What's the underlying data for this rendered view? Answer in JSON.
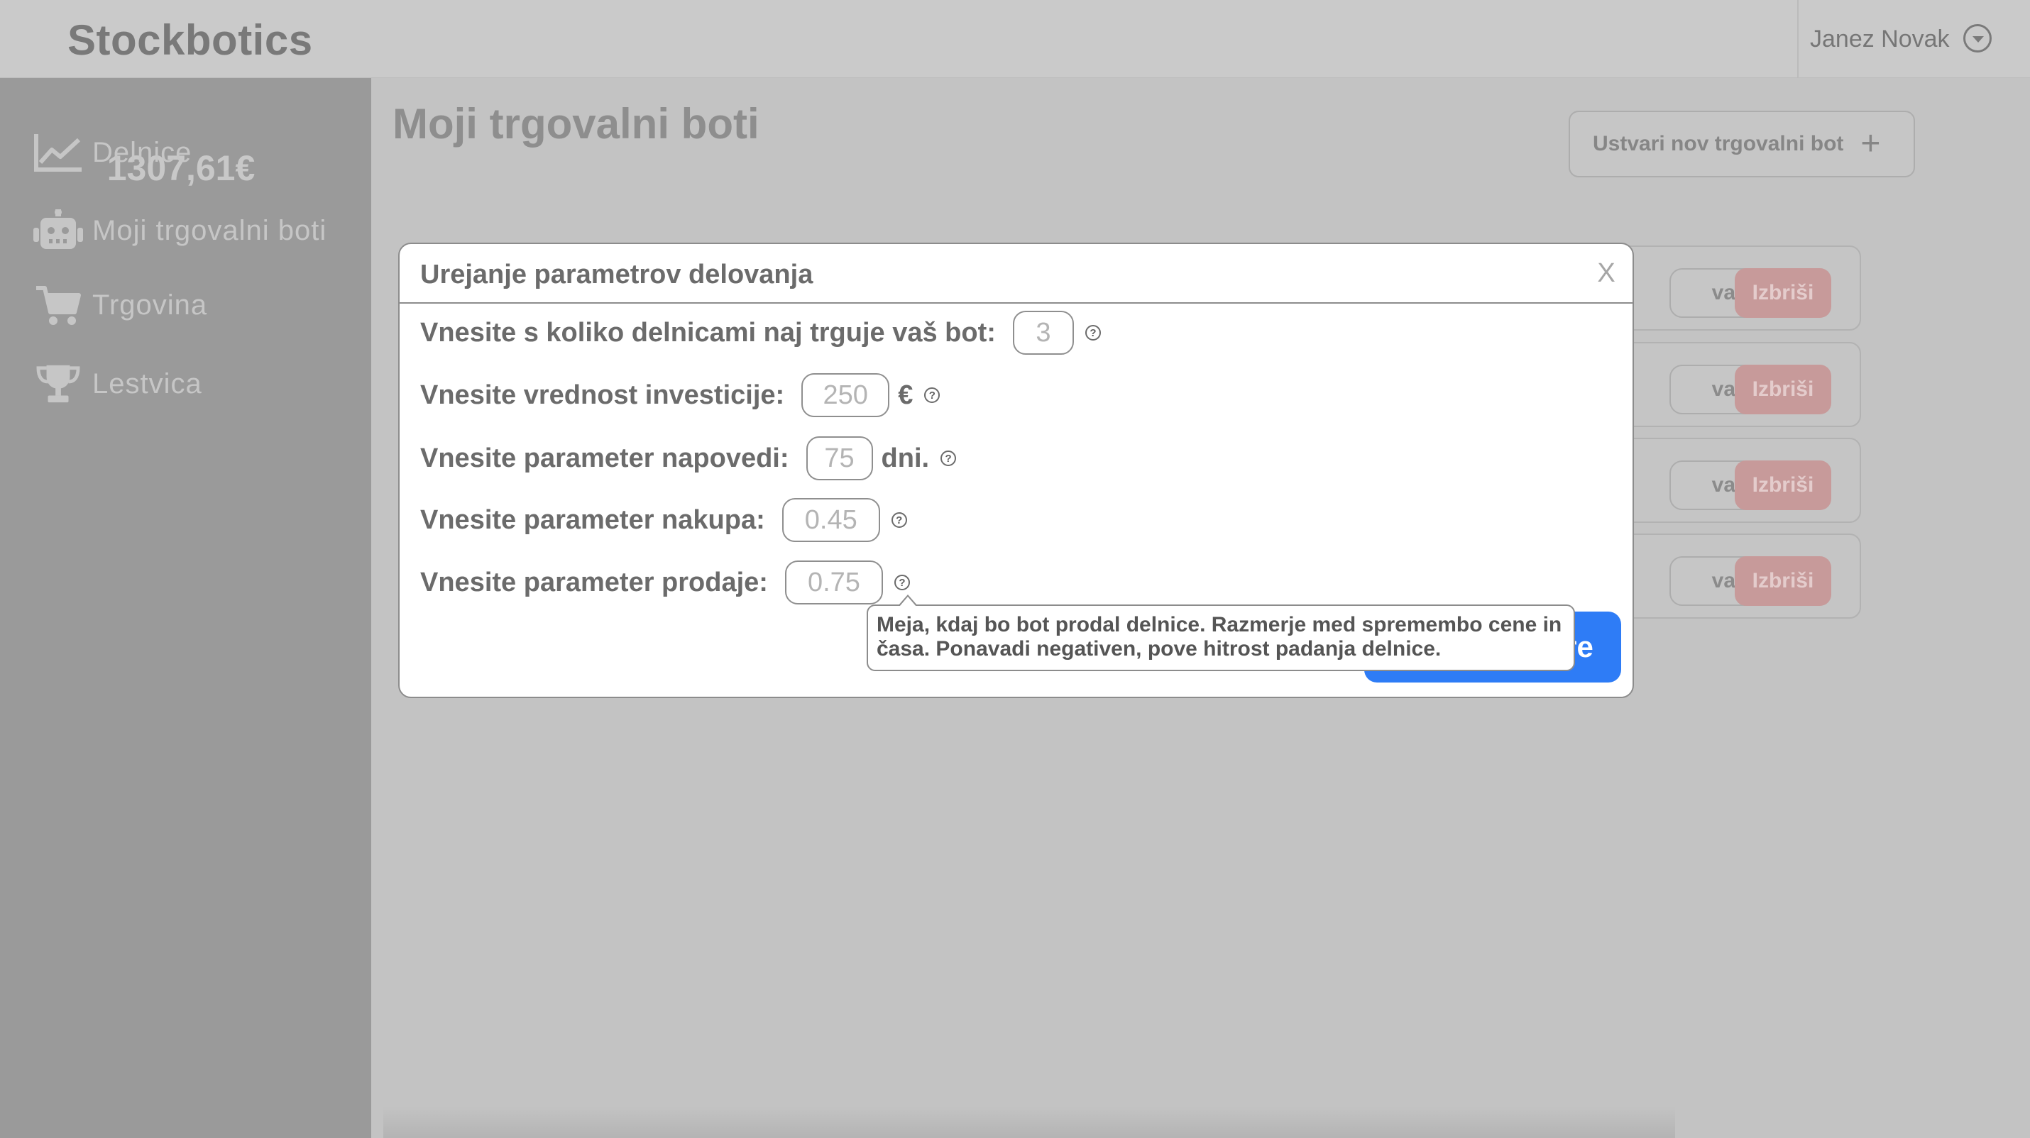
{
  "header": {
    "brand": "Stockbotics",
    "user_name": "Janez Novak",
    "user_dropdown_icon": "chevron-down-circle-icon"
  },
  "sidebar": {
    "balance": "1307,61€",
    "items": [
      {
        "label": "Delnice",
        "icon": "chart-line-icon"
      },
      {
        "label": "Moji trgovalni boti",
        "icon": "robot-icon"
      },
      {
        "label": "Trgovina",
        "icon": "cart-icon"
      },
      {
        "label": "Lestvica",
        "icon": "trophy-icon"
      }
    ]
  },
  "main": {
    "title": "Moji trgovalni boti",
    "create_button": "Ustvari nov trgovalni bot",
    "create_icon": "plus-icon",
    "bot_cards": [
      {
        "edit_label": "vanja",
        "delete_label": "Izbriši"
      },
      {
        "edit_label": "vanja",
        "delete_label": "Izbriši"
      },
      {
        "edit_label": "vanja",
        "delete_label": "Izbriši"
      },
      {
        "edit_label": "vanja",
        "delete_label": "Izbriši"
      }
    ]
  },
  "modal": {
    "title": "Urejanje parametrov delovanja",
    "close": "X",
    "params": [
      {
        "label": "Vnesite s koliko delnicami naj trguje vaš bot:",
        "placeholder": "3",
        "unit": ""
      },
      {
        "label": "Vnesite vrednost investicije:",
        "placeholder": "250",
        "unit": "€"
      },
      {
        "label": "Vnesite parameter napovedi:",
        "placeholder": "75",
        "unit": "dni."
      },
      {
        "label": "Vnesite parameter nakupa:",
        "placeholder": "0.45",
        "unit": ""
      },
      {
        "label": "Vnesite parameter prodaje:",
        "placeholder": "0.75",
        "unit": ""
      }
    ],
    "help_glyph": "?",
    "save_button": "tre",
    "tooltip": "Meja, kdaj bo bot prodal delnice. Razmerje med spremembo cene in časa. Ponavadi negativen,  pove hitrost padanja delnice."
  },
  "colors": {
    "overlay_bg": "#c3c3c3",
    "sidebar_bg": "#9a9a9a",
    "primary": "#2e7cf6",
    "delete": "#c79a9a",
    "modal_bg": "#ffffff"
  }
}
